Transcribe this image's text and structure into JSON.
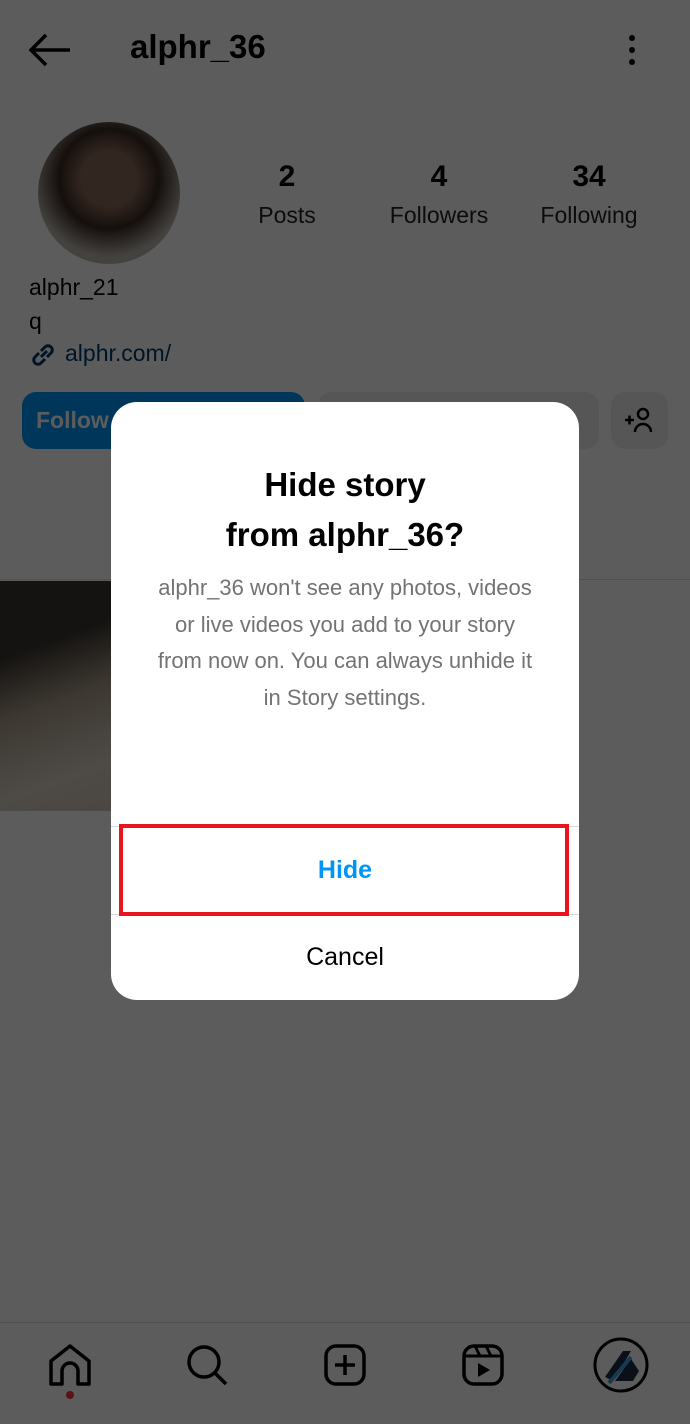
{
  "header": {
    "back_icon": "arrow-left-icon",
    "username": "alphr_36",
    "more_icon": "more-vertical-icon"
  },
  "profile": {
    "stats": [
      {
        "value": "2",
        "label": "Posts"
      },
      {
        "value": "4",
        "label": "Followers"
      },
      {
        "value": "34",
        "label": "Following"
      }
    ],
    "name": "alphr_21",
    "bio": "q",
    "link": "alphr.com/",
    "link_color": "#00376b",
    "follow_label": "Follow",
    "follow_color": "#0095f6"
  },
  "dialog": {
    "title_line1": "Hide story",
    "title_line2": "from alphr_36?",
    "body": "alphr_36 won't see any photos, videos or live videos you add to your story from now on. You can always unhide it in Story settings.",
    "hide_label": "Hide",
    "cancel_label": "Cancel",
    "hide_color": "#0095f6",
    "highlight_color": "#e8141e"
  },
  "bottom_nav": [
    "home-icon",
    "search-icon",
    "create-icon",
    "reels-icon",
    "profile-avatar"
  ]
}
